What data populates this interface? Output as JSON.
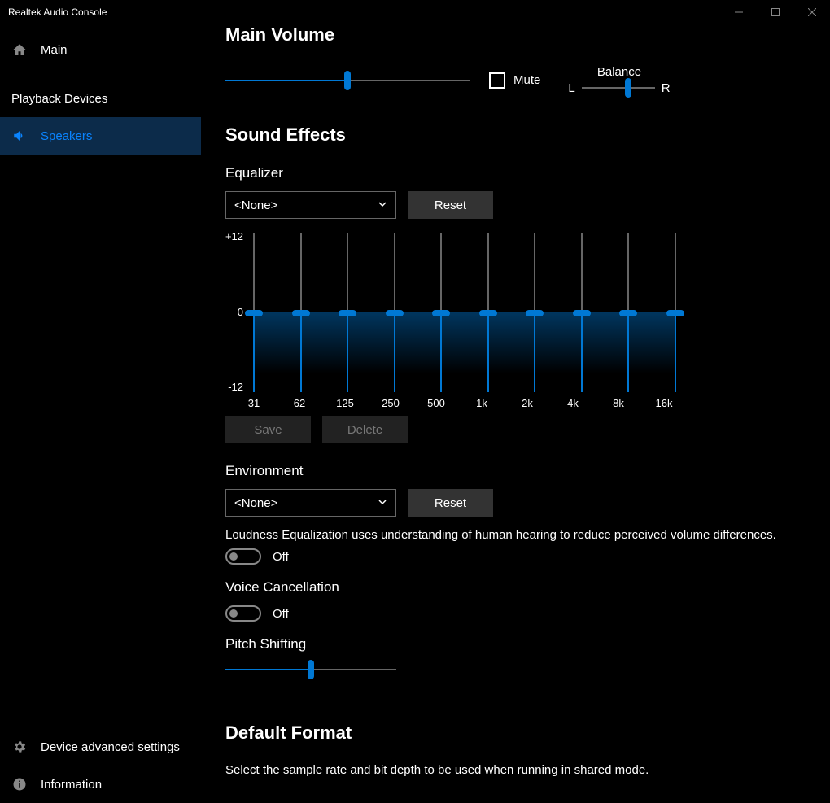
{
  "titlebar": {
    "title": "Realtek Audio Console"
  },
  "sidebar": {
    "main": "Main",
    "playback_devices": "Playback Devices",
    "speakers": "Speakers",
    "device_advanced": "Device advanced settings",
    "information": "Information"
  },
  "main_volume": {
    "title": "Main Volume",
    "mute": "Mute",
    "balance": "Balance",
    "L": "L",
    "R": "R"
  },
  "sound_effects": {
    "title": "Sound Effects",
    "equalizer": "Equalizer",
    "preset": "<None>",
    "reset": "Reset",
    "plus12": "+12",
    "zero": "0",
    "minus12": "-12",
    "bands": [
      "31",
      "62",
      "125",
      "250",
      "500",
      "1k",
      "2k",
      "4k",
      "8k",
      "16k"
    ],
    "save": "Save",
    "delete": "Delete",
    "environment": "Environment",
    "env_preset": "<None>",
    "loudness_desc": "Loudness Equalization uses understanding of human hearing to reduce perceived volume differences.",
    "off": "Off",
    "voice_cancel": "Voice Cancellation",
    "pitch": "Pitch Shifting"
  },
  "default_format": {
    "title": "Default Format",
    "desc": "Select the sample rate and bit depth to be used when running in shared mode."
  }
}
